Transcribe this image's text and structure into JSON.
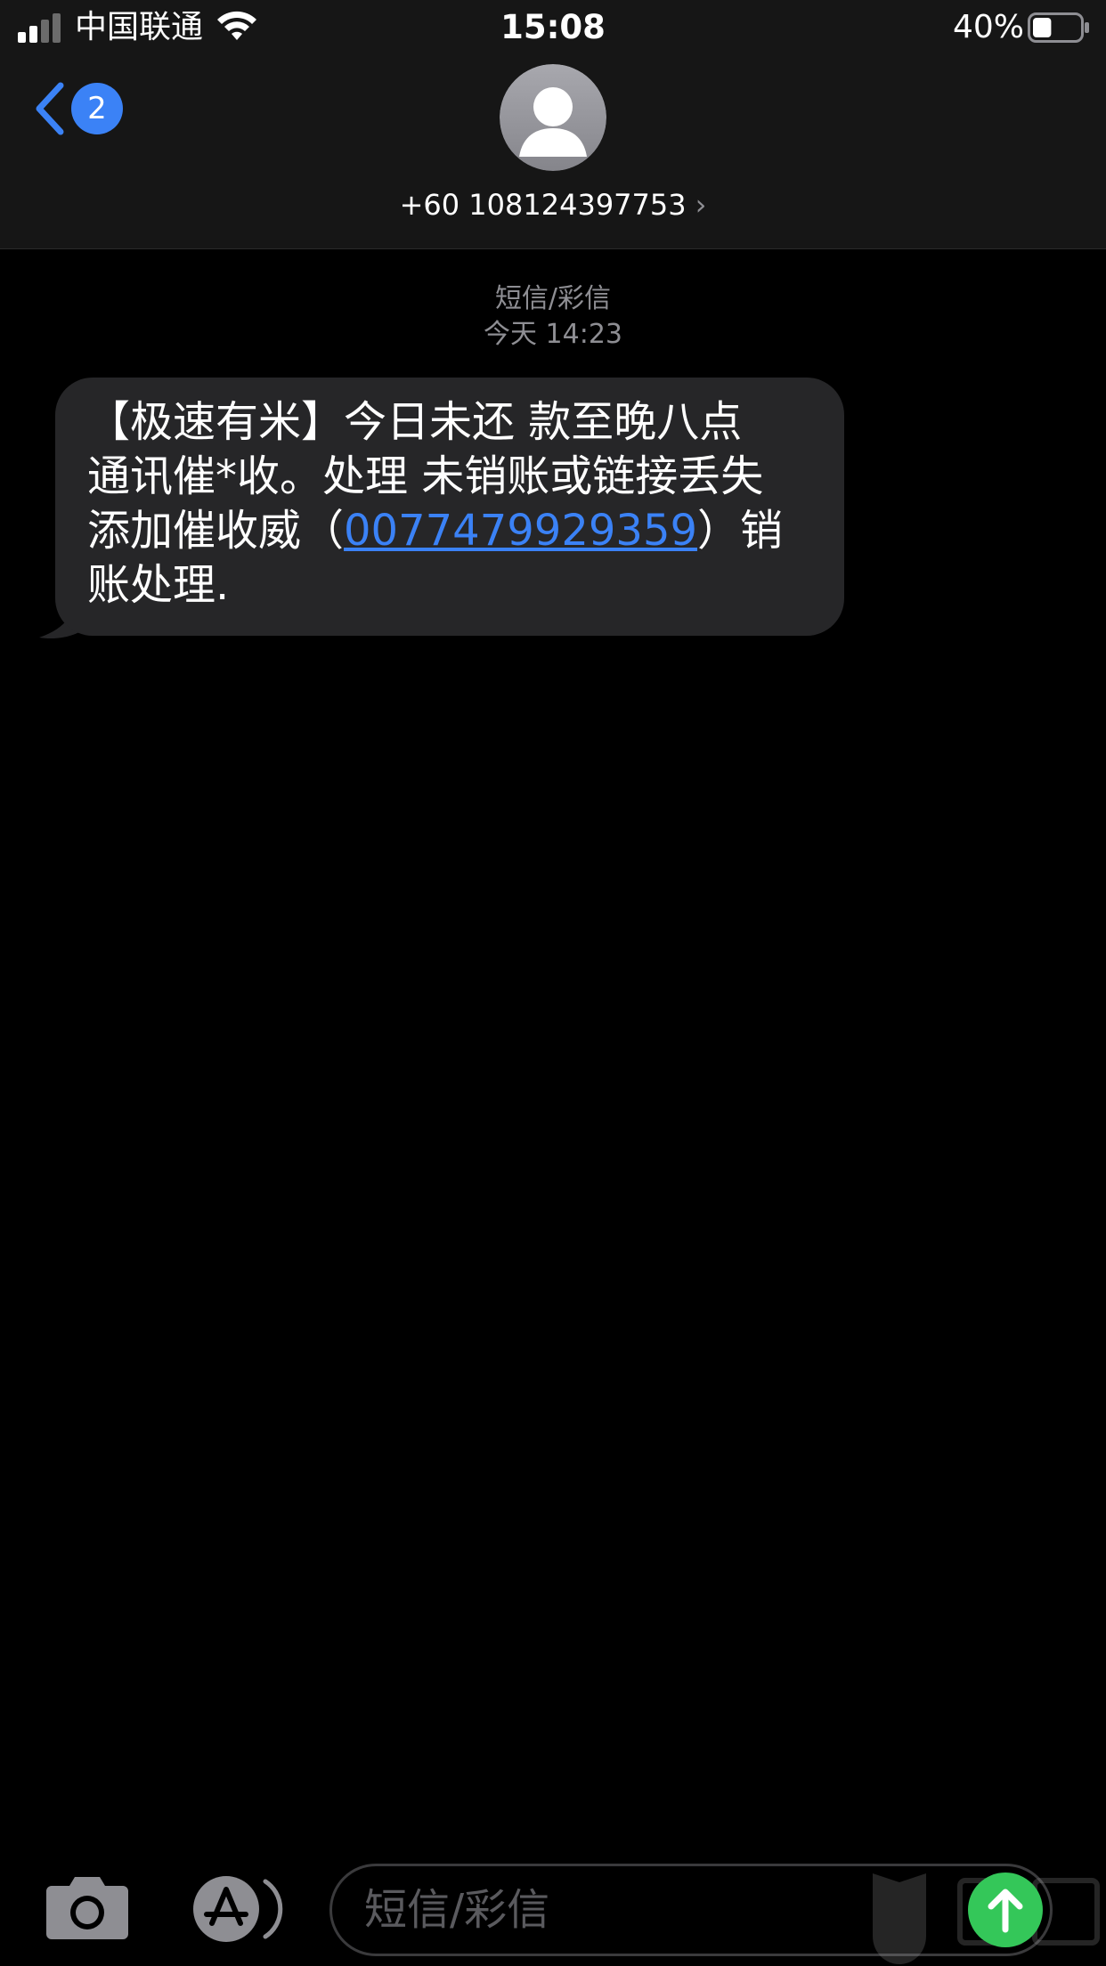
{
  "status_bar": {
    "carrier": "中国联通",
    "time": "15:08",
    "battery_percent": "40%",
    "battery_level": 0.4,
    "signal_bars": 2
  },
  "nav": {
    "back_badge": "2",
    "contact": "+60 108124397753"
  },
  "conversation": {
    "service": "短信/彩信",
    "timestamp": "今天 14:23",
    "message": {
      "line1": "【极速有米】今日未还 款至晚八点",
      "line2": "通讯催*收。处理 未销账或链接丢失",
      "line3_prefix": "添加催收威（",
      "line3_link": "0077479929359",
      "line3_suffix": "）销",
      "line4": "账处理."
    }
  },
  "composer": {
    "placeholder": "短信/彩信"
  },
  "colors": {
    "accent": "#3b82f6",
    "bubble": "#262628",
    "send": "#34c759"
  },
  "icons": [
    "signal-icon",
    "wifi-icon",
    "battery-icon",
    "back-chevron-icon",
    "avatar-icon",
    "chevron-right-icon",
    "camera-icon",
    "appstore-icon",
    "send-arrow-icon"
  ]
}
